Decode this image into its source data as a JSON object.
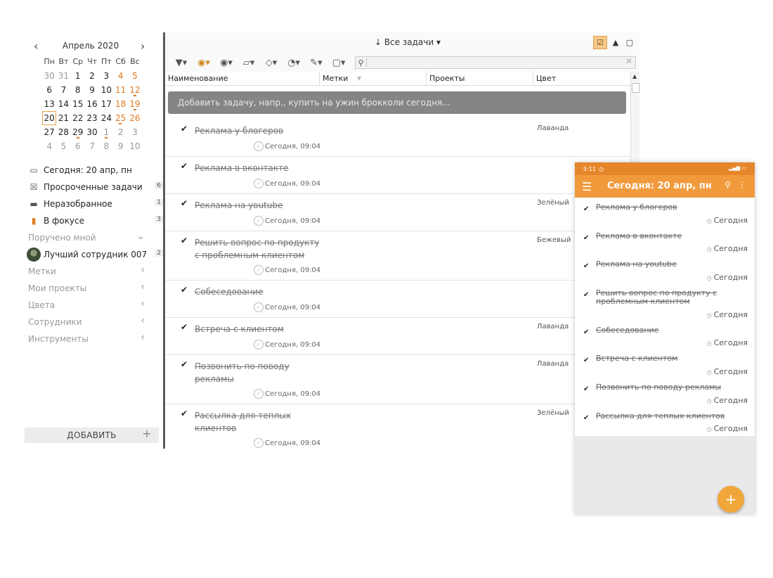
{
  "calendar": {
    "title": "Апрель 2020",
    "weekdays": [
      "Пн",
      "Вт",
      "Ср",
      "Чт",
      "Пт",
      "Сб",
      "Вс"
    ],
    "weeks": [
      [
        "30",
        "31",
        "1",
        "2",
        "3",
        "4",
        "5"
      ],
      [
        "6",
        "7",
        "8",
        "9",
        "10",
        "11",
        "12"
      ],
      [
        "13",
        "14",
        "15",
        "16",
        "17",
        "18",
        "19"
      ],
      [
        "20",
        "21",
        "22",
        "23",
        "24",
        "25",
        "26"
      ],
      [
        "27",
        "28",
        "29",
        "30",
        "1",
        "2",
        "3"
      ],
      [
        "4",
        "5",
        "6",
        "7",
        "8",
        "9",
        "10"
      ]
    ],
    "selected": "20"
  },
  "sidebar": {
    "today": "Сегодня: 20 апр, пн",
    "overdue": {
      "label": "Просроченные задачи",
      "count": "6"
    },
    "inbox": {
      "label": "Неразобранное",
      "count": "1"
    },
    "focus": {
      "label": "В фокусе",
      "count": "3"
    },
    "assigned_by_me": "Поручено мной",
    "employee": {
      "label": "Лучший сотрудник 007",
      "count": "2"
    },
    "groups": [
      "Метки",
      "Мои проекты",
      "Цвета",
      "Сотрудники",
      "Инструменты"
    ],
    "add_button": "ДОБАВИТЬ"
  },
  "main": {
    "view_title": "↓ Все задачи ▾",
    "columns": [
      "Наименование",
      "Метки",
      "Проекты",
      "Цвет"
    ],
    "quick_add_placeholder": "Добавить задачу, напр., купить на ужин брокколи сегодня...",
    "tasks": [
      {
        "name": "Реклама у блогеров",
        "due": "Сегодня, 09:04",
        "color": "Лаванда"
      },
      {
        "name": "Реклама в вконтакте",
        "due": "Сегодня, 09:04",
        "color": ""
      },
      {
        "name": "Реклама на youtube",
        "due": "Сегодня, 09:04",
        "color": "Зелёный"
      },
      {
        "name": "Решить вопрос по продукту с проблемным клиентом",
        "due": "Сегодня, 09:04",
        "color": "Бежевый"
      },
      {
        "name": "Собеседование",
        "due": "Сегодня, 09:04",
        "color": ""
      },
      {
        "name": "Встреча с клиентом",
        "due": "Сегодня, 09:04",
        "color": "Лаванда"
      },
      {
        "name": "Позвонить по поводу рекламы",
        "due": "Сегодня, 09:04",
        "color": "Лаванда"
      },
      {
        "name": "Рассылка для теплых клиентов",
        "due": "Сегодня, 09:04",
        "color": "Зелёный"
      }
    ]
  },
  "phone": {
    "time": "9:11",
    "title": "Сегодня: 20 апр, пн",
    "tasks": [
      {
        "name": "Реклама у блогеров",
        "due": "Сегодня"
      },
      {
        "name": "Реклама в вконтакте",
        "due": "Сегодня"
      },
      {
        "name": "Реклама на youtube",
        "due": "Сегодня"
      },
      {
        "name": "Решить вопрос по продукту с проблемным клиентом",
        "due": "Сегодня"
      },
      {
        "name": "Собеседование",
        "due": "Сегодня"
      },
      {
        "name": "Встреча с клиентом",
        "due": "Сегодня"
      },
      {
        "name": "Позвонить по поводу рекламы",
        "due": "Сегодня"
      },
      {
        "name": "Рассылка для теплых клиентов",
        "due": "Сегодня"
      }
    ]
  },
  "colors": {
    "accent": "#f19a3c",
    "weekend": "#e07a20",
    "focus_flag": "#e07a20"
  }
}
